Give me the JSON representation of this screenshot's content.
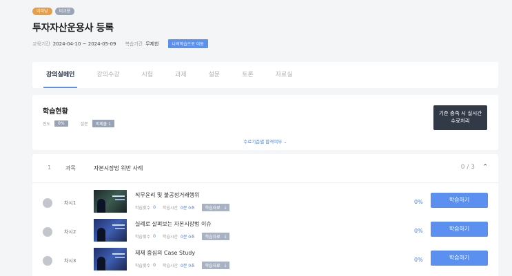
{
  "header": {
    "badges": [
      "이러닝",
      "비교용"
    ],
    "title": "투자자산운용사 등록",
    "period_label": "교육기간",
    "period_value": "2024-04-10 ~ 2024-05-09",
    "review_label": "복습기간",
    "review_value": "무제한",
    "my_learning_label": "나의학습으로 이동"
  },
  "tabs": [
    "강의실메인",
    "강의수강",
    "시험",
    "과제",
    "설문",
    "토론",
    "자료실"
  ],
  "status": {
    "title": "학습현황",
    "progress_label": "진도",
    "progress_value": "0%",
    "survey_label": "설문",
    "survey_value": "미제출 1",
    "complete_button": [
      "기준 충족 시 실시간",
      "수료처리"
    ],
    "criteria_link": "수료기준별 합격여부 ⌄"
  },
  "course": {
    "number": "1",
    "label": "과목",
    "name": "자본시장법 위반 사례",
    "count": "0 / 3",
    "lessons": [
      {
        "chapter": "차시1",
        "title": "직무윤리 및 불공정거래행위",
        "count_label": "학습횟수",
        "count": "0",
        "time_label": "학습시간",
        "time": "0분 0초",
        "material": "학습자료",
        "percent": "0%",
        "button": "학습하기"
      },
      {
        "chapter": "차시2",
        "title": "실례로 살펴보는 자본시장법 이슈",
        "count_label": "학습횟수",
        "count": "0",
        "time_label": "학습시간",
        "time": "0분 0초",
        "material": "학습자료",
        "percent": "0%",
        "button": "학습하기"
      },
      {
        "chapter": "차시3",
        "title": "제재 중심의 Case Study",
        "count_label": "학습횟수",
        "count": "0",
        "time_label": "학습시간",
        "time": "0분 0초",
        "material": "학습자료",
        "percent": "0%",
        "button": "학습하기"
      }
    ]
  }
}
